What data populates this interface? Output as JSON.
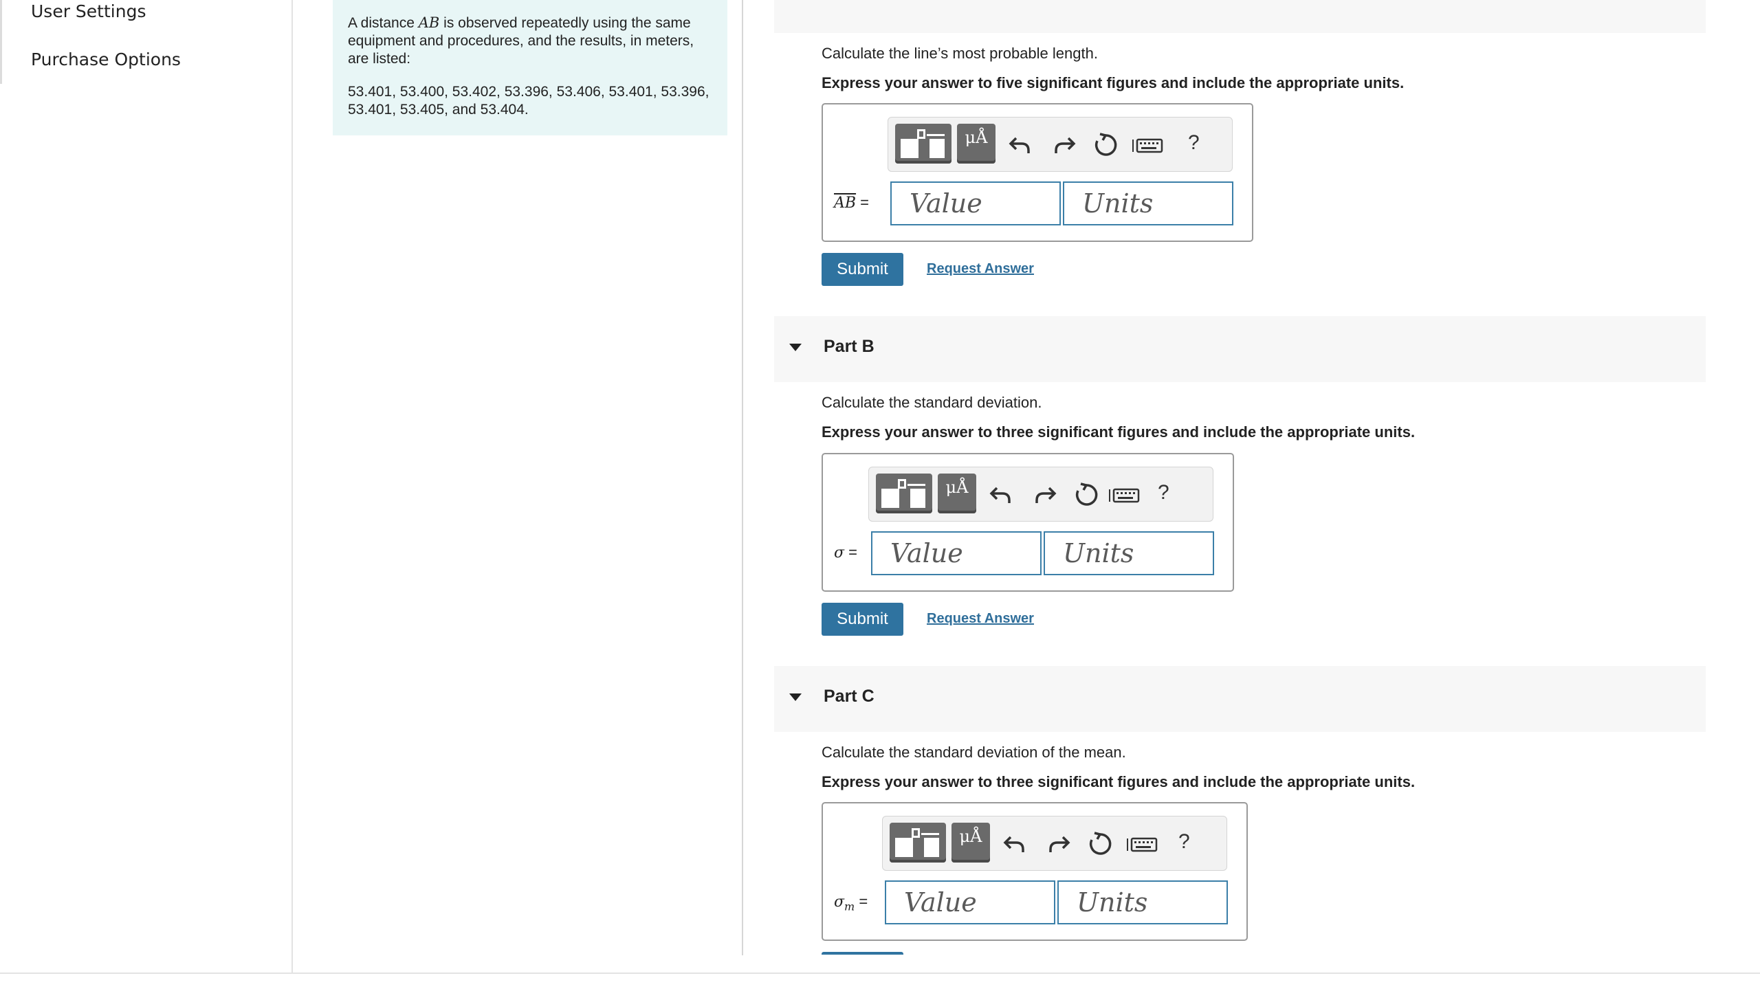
{
  "sidebar": {
    "items": [
      {
        "label": "User Settings"
      },
      {
        "label": "Purchase Options"
      }
    ]
  },
  "intro": {
    "line1_pre": "A distance ",
    "line1_var": "AB",
    "line1_post": " is observed repeatedly using the same equipment and procedures, and the results, in meters, are listed:",
    "values": "53.401, 53.400, 53.402, 53.396, 53.406, 53.401, 53.396, 53.401, 53.405, and 53.404."
  },
  "partA": {
    "prompt": "Calculate the line’s most probable length.",
    "instruction": "Express your answer to five significant figures and include the appropriate units.",
    "label_var": "AB",
    "label_eq": " =",
    "value_placeholder": "Value",
    "units_placeholder": "Units",
    "submit": "Submit",
    "request": "Request Answer"
  },
  "partB": {
    "title": "Part B",
    "prompt": "Calculate the standard deviation.",
    "instruction": "Express your answer to three significant figures and include the appropriate units.",
    "label_var": "σ",
    "label_eq": " =",
    "value_placeholder": "Value",
    "units_placeholder": "Units",
    "submit": "Submit",
    "request": "Request Answer"
  },
  "partC": {
    "title": "Part C",
    "prompt": "Calculate the standard deviation of the mean.",
    "instruction": "Express your answer to three significant figures and include the appropriate units.",
    "label_var": "σ",
    "label_sub": "m",
    "label_eq": " =",
    "value_placeholder": "Value",
    "units_placeholder": "Units"
  },
  "toolbar": {
    "mu_label": "μÅ",
    "help_label": "?",
    "icons": [
      "templates-icon",
      "units-icon",
      "undo-icon",
      "redo-icon",
      "reset-icon",
      "keyboard-icon",
      "help-icon"
    ]
  },
  "colors": {
    "intro_bg": "#e8f6f6",
    "submit_bg": "#2f73a0",
    "link": "#2f6e9a",
    "input_border": "#3b7fa8"
  }
}
